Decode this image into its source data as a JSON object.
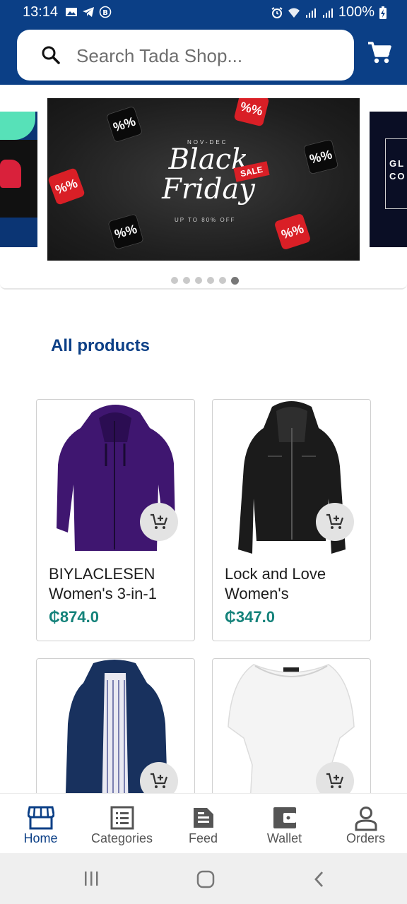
{
  "status_bar": {
    "time": "13:14",
    "battery": "100%",
    "left_icons": [
      "image-icon",
      "telegram-icon",
      "b-circle-icon"
    ],
    "right_icons": [
      "alarm-icon",
      "wifi-icon",
      "signal-icon",
      "signal-icon",
      "battery-charging-icon"
    ]
  },
  "header": {
    "search_placeholder": "Search Tada Shop...",
    "background_color": "#0b3f86"
  },
  "banner": {
    "top_text": "NOV-DEC",
    "title_line1": "Black",
    "title_line2": "Friday",
    "tag": "SALE",
    "subtitle": "UP TO 80% OFF",
    "cube_symbol": "%",
    "right_peek_text": [
      "GL",
      "CO"
    ],
    "dots_count": 6,
    "active_dot": 6
  },
  "section": {
    "title": "All products"
  },
  "products": [
    {
      "name": "BIYLACLESEN Women's 3-in-1",
      "price": "₵874.0"
    },
    {
      "name": "Lock and Love Women's",
      "price": "₵347.0"
    },
    {
      "name": "",
      "price": ""
    },
    {
      "name": "",
      "price": ""
    }
  ],
  "bottom_nav": [
    {
      "label": "Home",
      "icon": "store-icon",
      "active": true
    },
    {
      "label": "Categories",
      "icon": "list-icon",
      "active": false
    },
    {
      "label": "Feed",
      "icon": "document-icon",
      "active": false
    },
    {
      "label": "Wallet",
      "icon": "wallet-icon",
      "active": false
    },
    {
      "label": "Orders",
      "icon": "person-icon",
      "active": false
    }
  ],
  "colors": {
    "brand": "#0b3f86",
    "price": "#14827a",
    "accent_red": "#d91f26"
  }
}
